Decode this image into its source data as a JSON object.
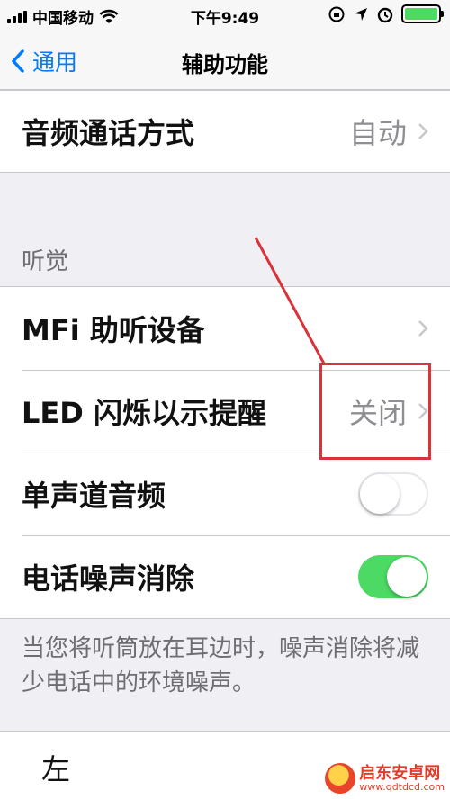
{
  "status_bar": {
    "carrier": "中国移动",
    "time": "下午9:49"
  },
  "nav": {
    "back_label": "通用",
    "title": "辅助功能"
  },
  "groups": [
    {
      "rows": [
        {
          "label": "音频通话方式",
          "value": "自动"
        }
      ]
    },
    {
      "header": "听觉",
      "rows": [
        {
          "label": "MFi 助听设备"
        },
        {
          "label": "LED 闪烁以示提醒",
          "value": "关闭"
        },
        {
          "label": "单声道音频",
          "toggle_on": false
        },
        {
          "label": "电话噪声消除",
          "toggle_on": true
        }
      ],
      "footer": "当您将听筒放在耳边时，噪声消除将减少电话中的环境噪声。"
    },
    {
      "rows": [
        {
          "label": "左"
        }
      ]
    }
  ],
  "watermark": {
    "name": "启东安卓网",
    "url": "www.qdtdcd.com"
  },
  "colors": {
    "accent": "#007aff",
    "toggle_on": "#4cd964",
    "annotation": "#d8323a"
  }
}
